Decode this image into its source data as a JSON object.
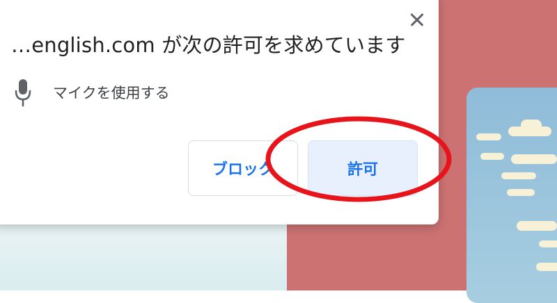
{
  "dialog": {
    "title": "…english.com が次の許可を求めています",
    "permission_label": "マイクを使用する",
    "permission_icon": "microphone-icon",
    "close_icon": "close-icon",
    "block_label": "ブロック",
    "allow_label": "許可"
  },
  "colors": {
    "button_text": "#1a73e8",
    "allow_bg": "#e8f0fe",
    "highlight_ring": "#e8141c",
    "background_red": "#cc7273"
  }
}
